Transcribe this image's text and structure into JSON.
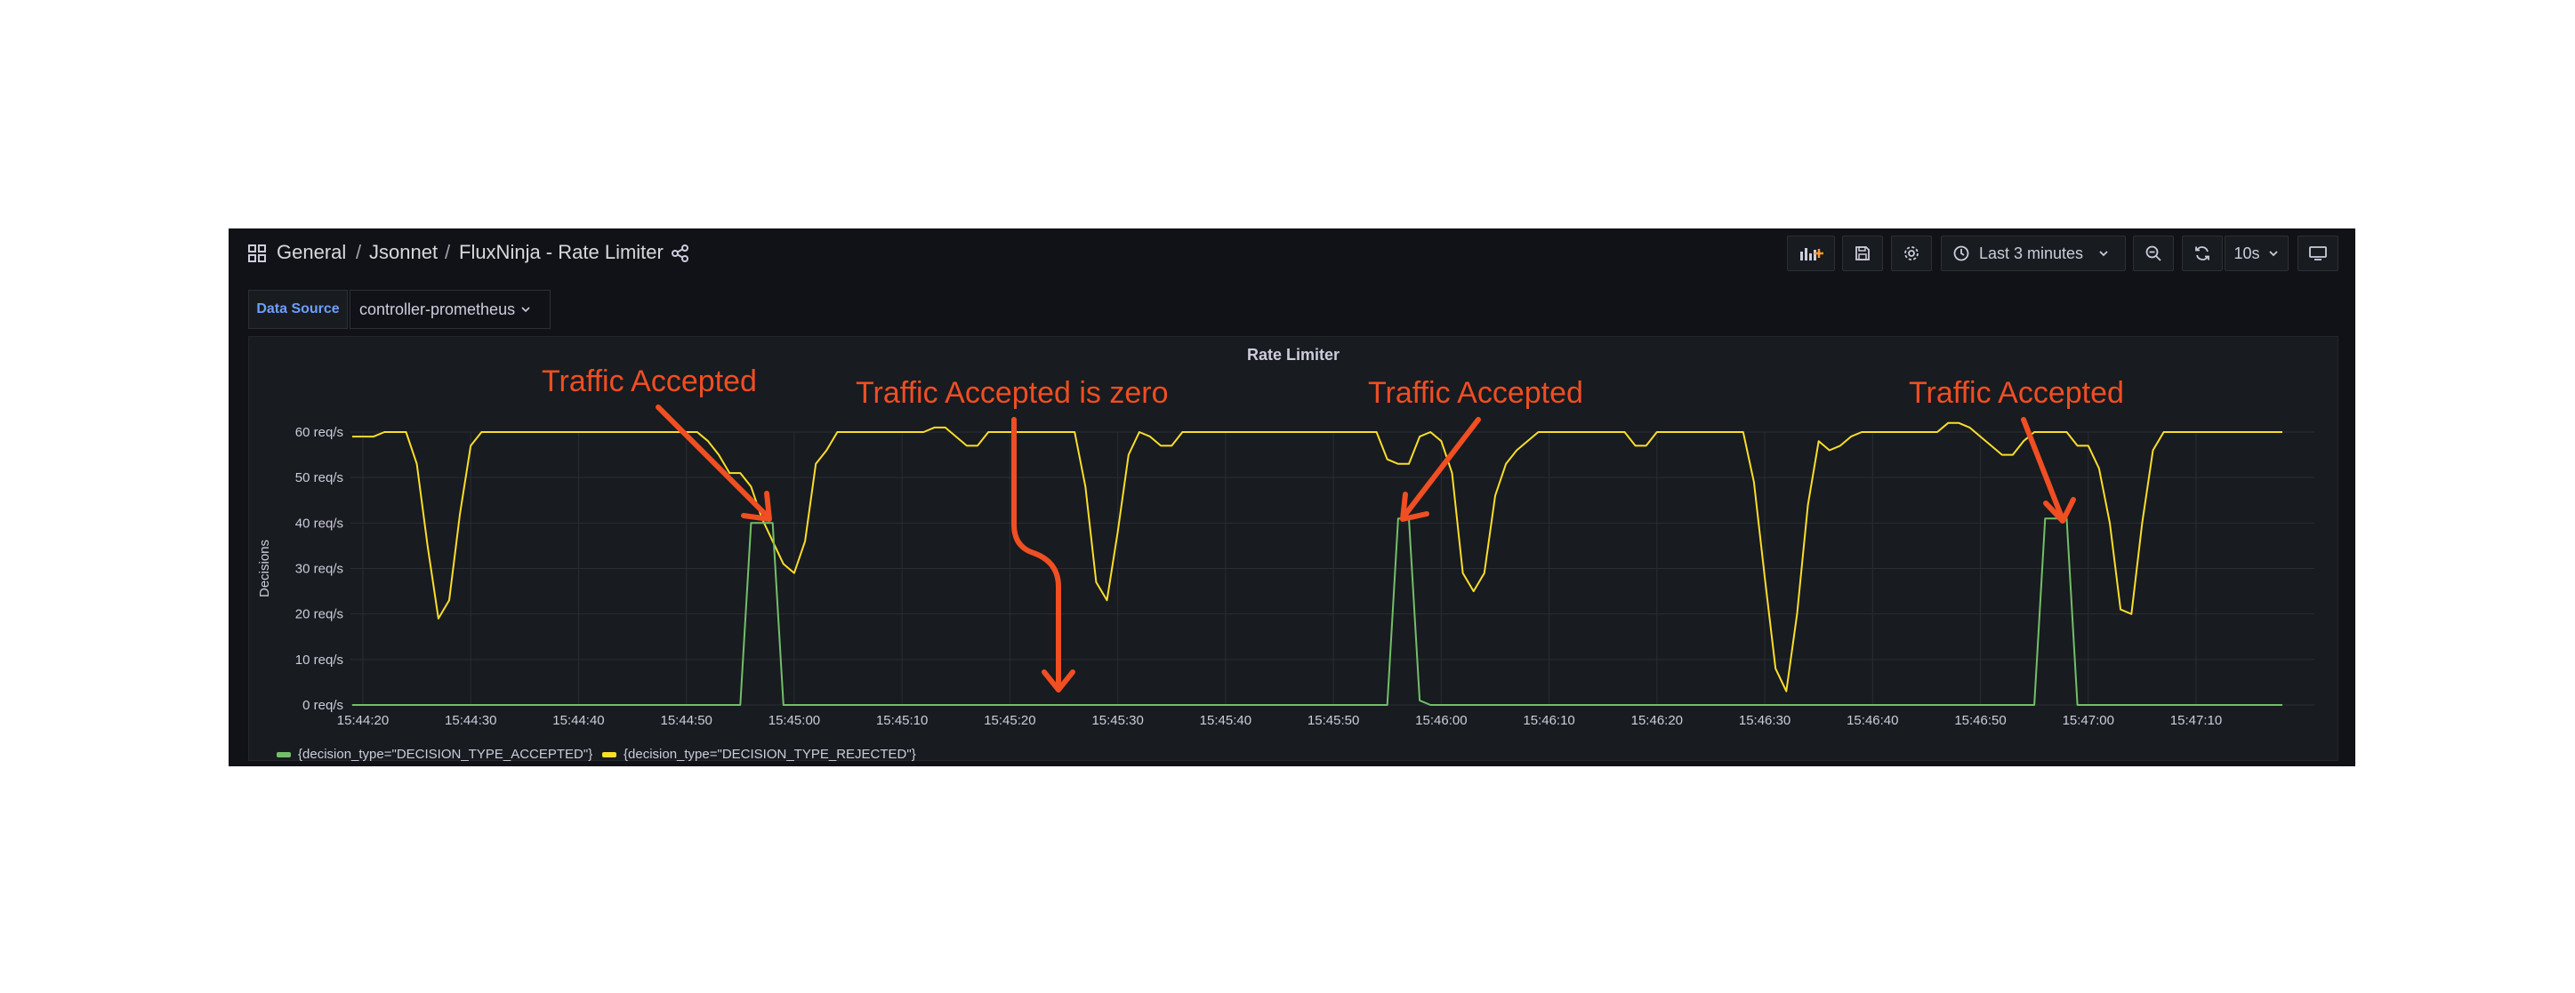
{
  "header": {
    "breadcrumb_root": "General",
    "breadcrumb_sep": "/",
    "breadcrumb_folder": "Jsonnet",
    "breadcrumb_title": "FluxNinja - Rate Limiter"
  },
  "toolbar": {
    "time_range": "Last 3 minutes",
    "refresh_interval": "10s"
  },
  "variables": {
    "datasource_label": "Data Source",
    "datasource_value": "controller-prometheus"
  },
  "panel": {
    "title": "Rate Limiter"
  },
  "annotations": {
    "a1": "Traffic Accepted",
    "a2": "Traffic Accepted is zero",
    "a3": "Traffic Accepted",
    "a4": "Traffic Accepted"
  },
  "colors": {
    "accepted": "#73bf69",
    "rejected": "#fade2a",
    "annotation": "#f04e23"
  },
  "chart_data": {
    "type": "line",
    "ylabel": "Decisions",
    "ylim": [
      0,
      60
    ],
    "y_ticks": [
      "0 req/s",
      "10 req/s",
      "20 req/s",
      "30 req/s",
      "40 req/s",
      "50 req/s",
      "60 req/s"
    ],
    "x_ticks": [
      "15:44:20",
      "15:44:30",
      "15:44:40",
      "15:44:50",
      "15:45:00",
      "15:45:10",
      "15:45:20",
      "15:45:30",
      "15:45:40",
      "15:45:50",
      "15:46:00",
      "15:46:10",
      "15:46:20",
      "15:46:30",
      "15:46:40",
      "15:46:50",
      "15:47:00",
      "15:47:10"
    ],
    "legend_position": "bottom-left",
    "grid": true,
    "series": [
      {
        "name": "{decision_type=\"DECISION_TYPE_ACCEPTED\"}",
        "color": "#73bf69",
        "points": [
          [
            "15:44:19",
            0
          ],
          [
            "15:44:55",
            0
          ],
          [
            "15:44:56",
            40
          ],
          [
            "15:44:58",
            40
          ],
          [
            "15:44:59",
            0
          ],
          [
            "15:45:55",
            0
          ],
          [
            "15:45:56",
            41
          ],
          [
            "15:45:57",
            41
          ],
          [
            "15:45:58",
            1
          ],
          [
            "15:45:59",
            0
          ],
          [
            "15:46:55",
            0
          ],
          [
            "15:46:56",
            41
          ],
          [
            "15:46:58",
            41
          ],
          [
            "15:46:59",
            0
          ],
          [
            "15:47:18",
            0
          ]
        ]
      },
      {
        "name": "{decision_type=\"DECISION_TYPE_REJECTED\"}",
        "color": "#fade2a",
        "points": [
          [
            "15:44:19",
            59
          ],
          [
            "15:44:21",
            59
          ],
          [
            "15:44:22",
            60
          ],
          [
            "15:44:24",
            60
          ],
          [
            "15:44:25",
            53
          ],
          [
            "15:44:26",
            35
          ],
          [
            "15:44:27",
            19
          ],
          [
            "15:44:28",
            23
          ],
          [
            "15:44:29",
            42
          ],
          [
            "15:44:30",
            57
          ],
          [
            "15:44:31",
            60
          ],
          [
            "15:44:51",
            60
          ],
          [
            "15:44:52",
            58
          ],
          [
            "15:44:53",
            55
          ],
          [
            "15:44:54",
            51
          ],
          [
            "15:44:55",
            51
          ],
          [
            "15:44:56",
            48
          ],
          [
            "15:44:57",
            41
          ],
          [
            "15:44:58",
            36
          ],
          [
            "15:44:59",
            31
          ],
          [
            "15:45:00",
            29
          ],
          [
            "15:45:01",
            36
          ],
          [
            "15:45:02",
            53
          ],
          [
            "15:45:03",
            56
          ],
          [
            "15:45:04",
            60
          ],
          [
            "15:45:12",
            60
          ],
          [
            "15:45:13",
            61
          ],
          [
            "15:45:14",
            61
          ],
          [
            "15:45:15",
            59
          ],
          [
            "15:45:16",
            57
          ],
          [
            "15:45:17",
            57
          ],
          [
            "15:45:18",
            60
          ],
          [
            "15:45:26",
            60
          ],
          [
            "15:45:27",
            48
          ],
          [
            "15:45:28",
            27
          ],
          [
            "15:45:29",
            23
          ],
          [
            "15:45:30",
            38
          ],
          [
            "15:45:31",
            55
          ],
          [
            "15:45:32",
            60
          ],
          [
            "15:45:33",
            59
          ],
          [
            "15:45:34",
            57
          ],
          [
            "15:45:35",
            57
          ],
          [
            "15:45:36",
            60
          ],
          [
            "15:45:54",
            60
          ],
          [
            "15:45:55",
            54
          ],
          [
            "15:45:56",
            53
          ],
          [
            "15:45:57",
            53
          ],
          [
            "15:45:58",
            59
          ],
          [
            "15:45:59",
            60
          ],
          [
            "15:46:00",
            58
          ],
          [
            "15:46:01",
            51
          ],
          [
            "15:46:02",
            29
          ],
          [
            "15:46:03",
            25
          ],
          [
            "15:46:04",
            29
          ],
          [
            "15:46:05",
            46
          ],
          [
            "15:46:06",
            53
          ],
          [
            "15:46:07",
            56
          ],
          [
            "15:46:08",
            58
          ],
          [
            "15:46:09",
            60
          ],
          [
            "15:46:17",
            60
          ],
          [
            "15:46:18",
            57
          ],
          [
            "15:46:19",
            57
          ],
          [
            "15:46:20",
            60
          ],
          [
            "15:46:28",
            60
          ],
          [
            "15:46:29",
            49
          ],
          [
            "15:46:30",
            28
          ],
          [
            "15:46:31",
            8
          ],
          [
            "15:46:32",
            3
          ],
          [
            "15:46:33",
            20
          ],
          [
            "15:46:34",
            44
          ],
          [
            "15:46:35",
            58
          ],
          [
            "15:46:36",
            56
          ],
          [
            "15:46:37",
            57
          ],
          [
            "15:46:38",
            59
          ],
          [
            "15:46:39",
            60
          ],
          [
            "15:46:46",
            60
          ],
          [
            "15:46:47",
            62
          ],
          [
            "15:46:48",
            62
          ],
          [
            "15:46:49",
            61
          ],
          [
            "15:46:50",
            59
          ],
          [
            "15:46:51",
            57
          ],
          [
            "15:46:52",
            55
          ],
          [
            "15:46:53",
            55
          ],
          [
            "15:46:54",
            58
          ],
          [
            "15:46:55",
            60
          ],
          [
            "15:46:58",
            60
          ],
          [
            "15:46:59",
            57
          ],
          [
            "15:47:00",
            57
          ],
          [
            "15:47:01",
            52
          ],
          [
            "15:47:02",
            40
          ],
          [
            "15:47:03",
            21
          ],
          [
            "15:47:04",
            20
          ],
          [
            "15:47:05",
            40
          ],
          [
            "15:47:06",
            56
          ],
          [
            "15:47:07",
            60
          ],
          [
            "15:47:18",
            60
          ]
        ]
      }
    ]
  }
}
